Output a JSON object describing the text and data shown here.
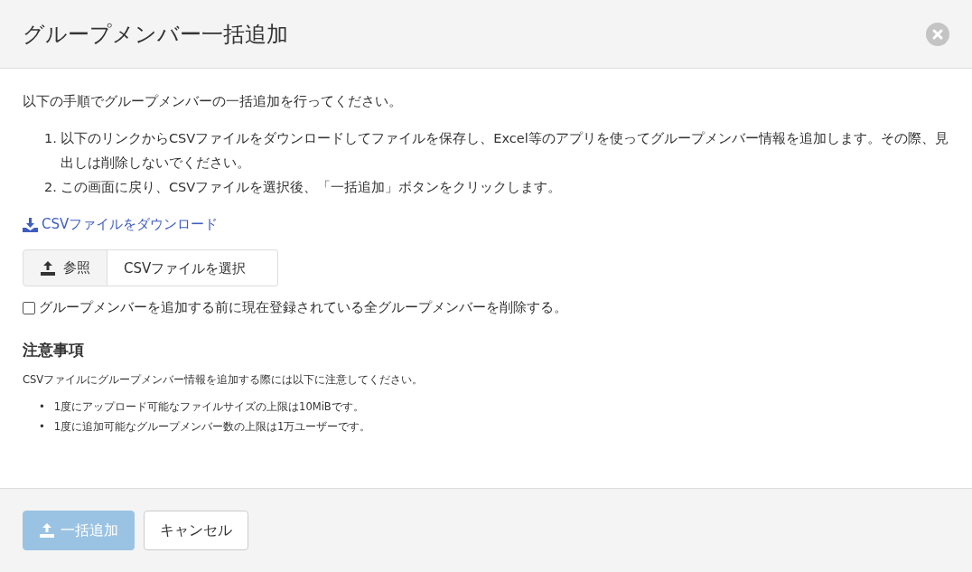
{
  "dialog": {
    "title": "グループメンバー一括追加"
  },
  "intro": "以下の手順でグループメンバーの一括追加を行ってください。",
  "steps": [
    {
      "marker": "1.",
      "text": "以下のリンクからCSVファイルをダウンロードしてファイルを保存し、Excel等のアプリを使ってグループメンバー情報を追加します。その際、見出しは削除しないでください。"
    },
    {
      "marker": "2.",
      "text": "この画面に戻り、CSVファイルを選択後、「一括追加」ボタンをクリックします。"
    }
  ],
  "download_link": "CSVファイルをダウンロード",
  "file_picker": {
    "browse_label": "参照",
    "placeholder": "CSVファイルを選択"
  },
  "delete_option": {
    "label": "グループメンバーを追加する前に現在登録されている全グループメンバーを削除する。",
    "checked": false
  },
  "notes": {
    "heading": "注意事項",
    "intro": "CSVファイルにグループメンバー情報を追加する際には以下に注意してください。",
    "items": [
      {
        "marker": "•",
        "text": "1度にアップロード可能なファイルサイズの上限は10MiBです。"
      },
      {
        "marker": "•",
        "text": "1度に追加可能なグループメンバー数の上限は1万ユーザーです。"
      }
    ]
  },
  "buttons": [
    {
      "label": "一括追加",
      "kind": "primary",
      "disabled": true
    },
    {
      "label": "キャンセル",
      "kind": "default",
      "disabled": false
    }
  ]
}
